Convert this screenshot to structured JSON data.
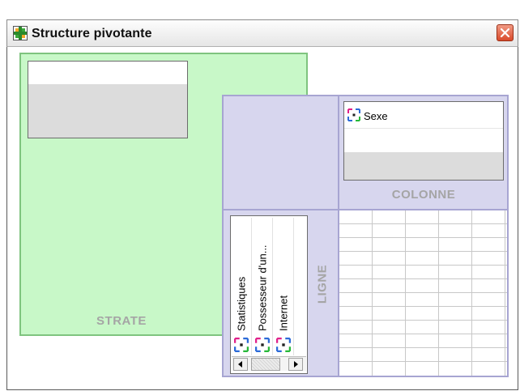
{
  "window": {
    "title": "Structure pivotante"
  },
  "strate": {
    "label": "STRATE"
  },
  "colonne": {
    "label": "COLONNE",
    "items": [
      {
        "label": "Sexe",
        "icon": "pivot-dimension-icon"
      }
    ]
  },
  "ligne": {
    "label": "LIGNE",
    "items": [
      {
        "label": "Statistiques",
        "icon": "pivot-dimension-icon"
      },
      {
        "label": "Possesseur d'un...",
        "icon": "pivot-dimension-icon"
      },
      {
        "label": "Internet",
        "icon": "pivot-dimension-icon"
      }
    ]
  },
  "icons": {
    "app": "pivot-app-icon",
    "close": "close-icon",
    "scroll_left": "arrow-left-icon",
    "scroll_right": "arrow-right-icon"
  },
  "colors": {
    "strate_bg": "#c8f8c8",
    "panel_bg": "#d7d6ee",
    "close_red": "#d94a2b"
  }
}
